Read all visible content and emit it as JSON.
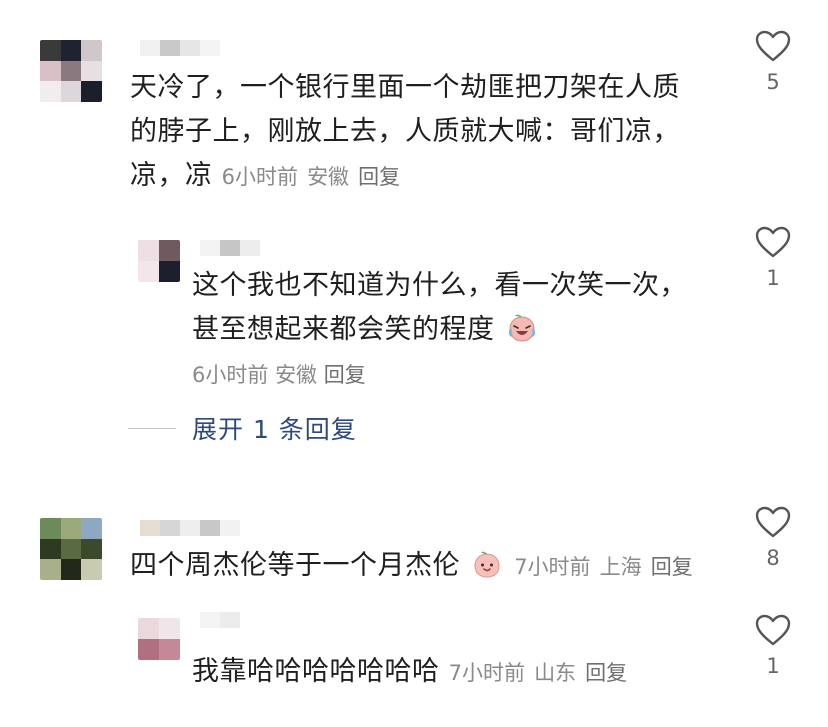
{
  "comments": [
    {
      "text_lines": [
        "天冷了，一个银行里面一个劫匪把刀架在人质",
        "的脖子上，刚放上去，人质就大喊：哥们凉，",
        "凉，凉"
      ],
      "time": "6小时前",
      "location": "安徽",
      "reply": "回复",
      "likes": "5"
    },
    {
      "text_lines": [
        "这个我也不知道为什么，看一次笑一次，",
        "甚至想起来都会笑的程度"
      ],
      "emoji": "crying-laughing-peach-emoji",
      "time": "6小时前",
      "location": "安徽",
      "reply": "回复",
      "likes": "1",
      "expand_label": "展开 1 条回复"
    },
    {
      "text": "四个周杰伦等于一个月杰伦",
      "emoji": "peach-smile-emoji",
      "time": "7小时前",
      "location": "上海",
      "reply": "回复",
      "likes": "8"
    },
    {
      "text": "我靠哈哈哈哈哈哈哈",
      "time": "7小时前",
      "location": "山东",
      "reply": "回复",
      "likes": "1"
    }
  ],
  "icons": {
    "like": "heart-outline-icon"
  },
  "colors": {
    "meta": "#8a8a8a",
    "expand": "#2d4a7a",
    "text": "#1f1f1f"
  }
}
